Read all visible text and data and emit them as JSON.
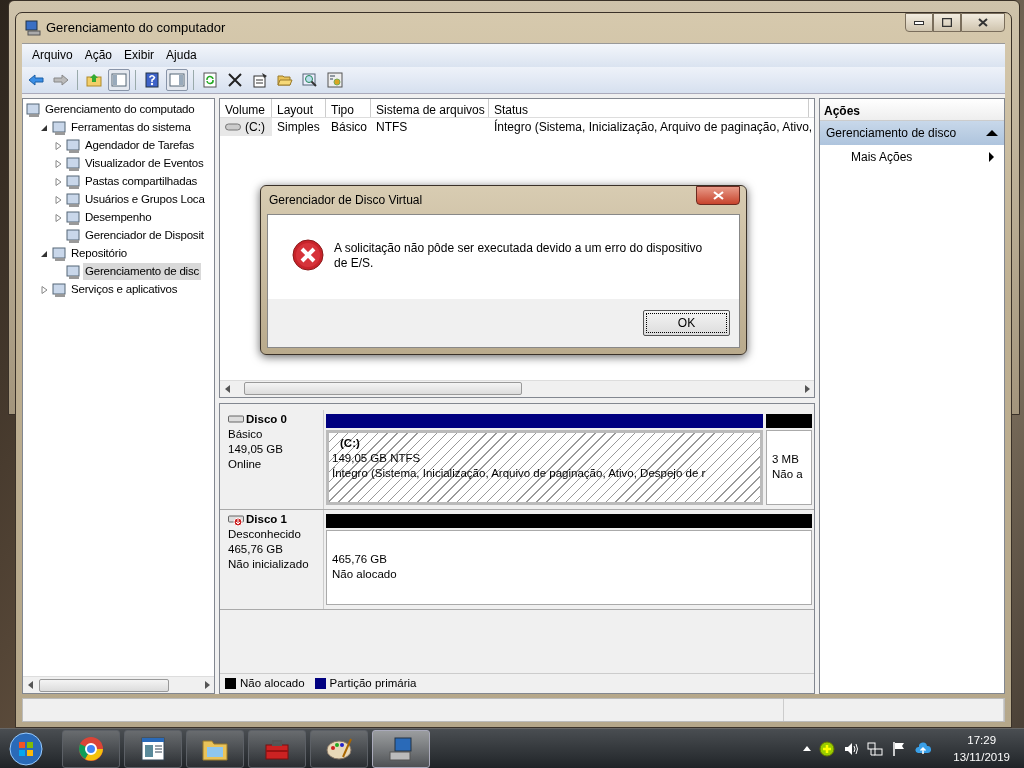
{
  "window": {
    "title": "Gerenciamento do computador"
  },
  "menu": [
    "Arquivo",
    "Ação",
    "Exibir",
    "Ajuda"
  ],
  "tree": [
    {
      "label": "Gerenciamento do computado",
      "selected": false,
      "children": [
        {
          "label": "Ferramentas do sistema",
          "selected": false,
          "expanded": true,
          "children": [
            {
              "label": "Agendador de Tarefas",
              "selected": false,
              "expanded": false
            },
            {
              "label": "Visualizador de Eventos",
              "selected": false,
              "expanded": false
            },
            {
              "label": "Pastas compartilhadas",
              "selected": false,
              "expanded": false
            },
            {
              "label": "Usuários e Grupos Loca",
              "selected": false,
              "expanded": false
            },
            {
              "label": "Desempenho",
              "selected": false,
              "expanded": false
            },
            {
              "label": "Gerenciador de Disposit",
              "selected": false
            }
          ]
        },
        {
          "label": "Repositório",
          "selected": false,
          "expanded": true,
          "children": [
            {
              "label": "Gerenciamento de disc",
              "selected": true
            }
          ]
        },
        {
          "label": "Serviços e aplicativos",
          "selected": false,
          "expanded": false
        }
      ]
    }
  ],
  "volume_table": {
    "columns": [
      "Volume",
      "Layout",
      "Tipo",
      "Sistema de arquivos",
      "Status"
    ],
    "rows": [
      {
        "selected": true,
        "cells": [
          "(C:)",
          "Simples",
          "Básico",
          "NTFS",
          "Íntegro (Sistema, Inicialização, Arquivo de paginação, Ativo,"
        ]
      }
    ]
  },
  "disks": [
    {
      "name": "Disco 0",
      "kind": "basic",
      "type": "Básico",
      "size": "149,05 GB",
      "state": "Online",
      "partitions": [
        {
          "kind": "primary",
          "selected": true,
          "label": "(C:)",
          "size": "149,05 GB NTFS",
          "status": "Íntegro (Sistema, Inicialização, Arquivo de paginação, Ativo, Despejo de r"
        },
        {
          "kind": "unallocated",
          "selected": false,
          "size": "3 MB",
          "status": "Não a"
        }
      ]
    },
    {
      "name": "Disco 1",
      "kind": "unknown",
      "type": "Desconhecido",
      "size": "465,76 GB",
      "state": "Não inicializado",
      "partitions": [
        {
          "kind": "unallocated",
          "selected": false,
          "size": "465,76 GB",
          "status": "Não alocado"
        }
      ]
    }
  ],
  "legend": [
    {
      "label": "Não alocado",
      "color": "#000000"
    },
    {
      "label": "Partição primária",
      "color": "#000080"
    }
  ],
  "actions": {
    "title": "Ações",
    "sections": [
      {
        "title": "Gerenciamento de disco",
        "expanded": true,
        "items": [
          {
            "label": "Mais Ações",
            "submenu": true
          }
        ]
      }
    ]
  },
  "dialog": {
    "title": "Gerenciador de Disco Virtual",
    "message": "A solicitação não pôde ser executada devido a um erro do dispositivo de E/S.",
    "buttons": [
      "OK"
    ]
  },
  "taskbar": {
    "apps": [
      {
        "kind": "browser",
        "selected": false
      },
      {
        "kind": "document",
        "selected": false
      },
      {
        "kind": "folder",
        "selected": false
      },
      {
        "kind": "toolbox",
        "selected": false
      },
      {
        "kind": "paint",
        "selected": false
      },
      {
        "kind": "console",
        "selected": true
      }
    ],
    "time": "17:29",
    "date": "13/11/2019"
  }
}
